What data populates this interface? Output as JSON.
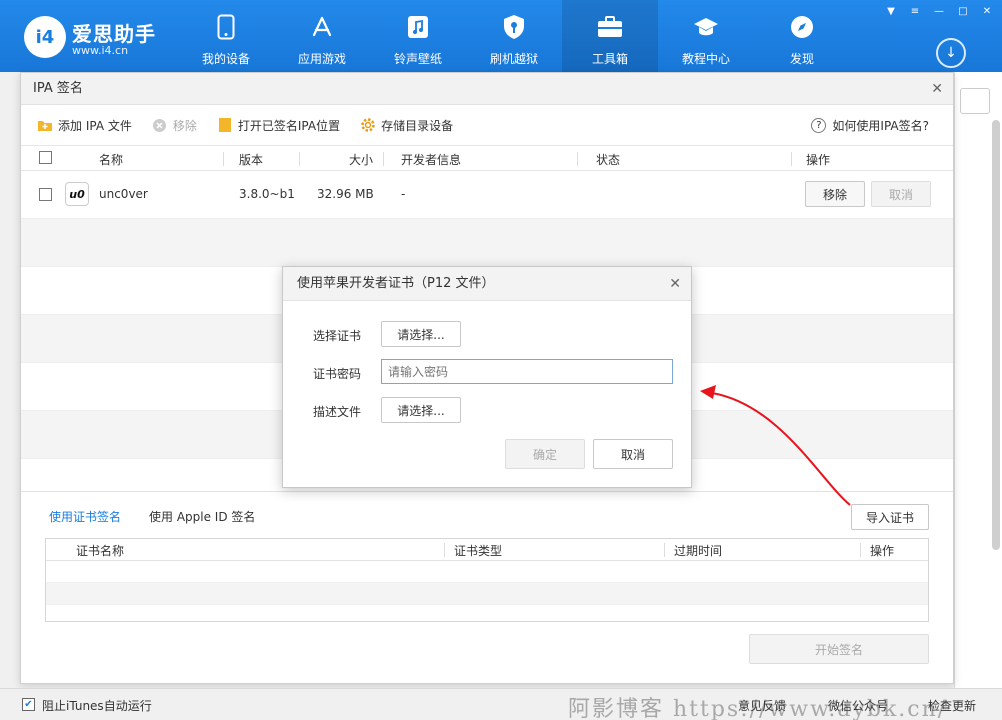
{
  "header": {
    "logo_text": "i4",
    "brand": "爱思助手",
    "site": "www.i4.cn",
    "nav": [
      {
        "label": "我的设备",
        "icon": "phone-icon"
      },
      {
        "label": "应用游戏",
        "icon": "appstore-icon"
      },
      {
        "label": "铃声壁纸",
        "icon": "music-icon"
      },
      {
        "label": "刷机越狱",
        "icon": "shield-icon"
      },
      {
        "label": "工具箱",
        "icon": "toolbox-icon"
      },
      {
        "label": "教程中心",
        "icon": "graduation-icon"
      },
      {
        "label": "发现",
        "icon": "compass-icon"
      }
    ],
    "active_index": 4
  },
  "ipa_dialog": {
    "title": "IPA 签名",
    "toolbar": {
      "add": "添加 IPA 文件",
      "remove": "移除",
      "open_location": "打开已签名IPA位置",
      "storage": "存储目录设备",
      "help": "如何使用IPA签名?"
    },
    "columns": {
      "name": "名称",
      "version": "版本",
      "size": "大小",
      "developer": "开发者信息",
      "status": "状态",
      "action": "操作"
    },
    "rows": [
      {
        "icon_text": "u0",
        "name": "unc0ver",
        "version": "3.8.0~b1",
        "size": "32.96 MB",
        "developer": "-",
        "remove": "移除",
        "cancel": "取消"
      }
    ],
    "tabs": {
      "cert_sign": "使用证书签名",
      "apple_id_sign": "使用 Apple ID 签名"
    },
    "import_cert": "导入证书",
    "cert_columns": {
      "name": "证书名称",
      "type": "证书类型",
      "expiry": "过期时间",
      "action": "操作"
    },
    "start_sign": "开始签名"
  },
  "p12_dialog": {
    "title": "使用苹果开发者证书（P12 文件）",
    "cert_label": "选择证书",
    "cert_button": "请选择...",
    "password_label": "证书密码",
    "password_placeholder": "请输入密码",
    "profile_label": "描述文件",
    "profile_button": "请选择...",
    "ok": "确定",
    "cancel": "取消"
  },
  "statusbar": {
    "block_itunes": "阻止iTunes自动运行",
    "feedback": "意见反馈",
    "wechat": "微信公众号",
    "check_update": "检查更新",
    "watermark": "阿影博客 https://www.aybk.cn/"
  },
  "colors": {
    "header_blue": "#1a7ee0",
    "annotation_red": "#e8141c"
  }
}
